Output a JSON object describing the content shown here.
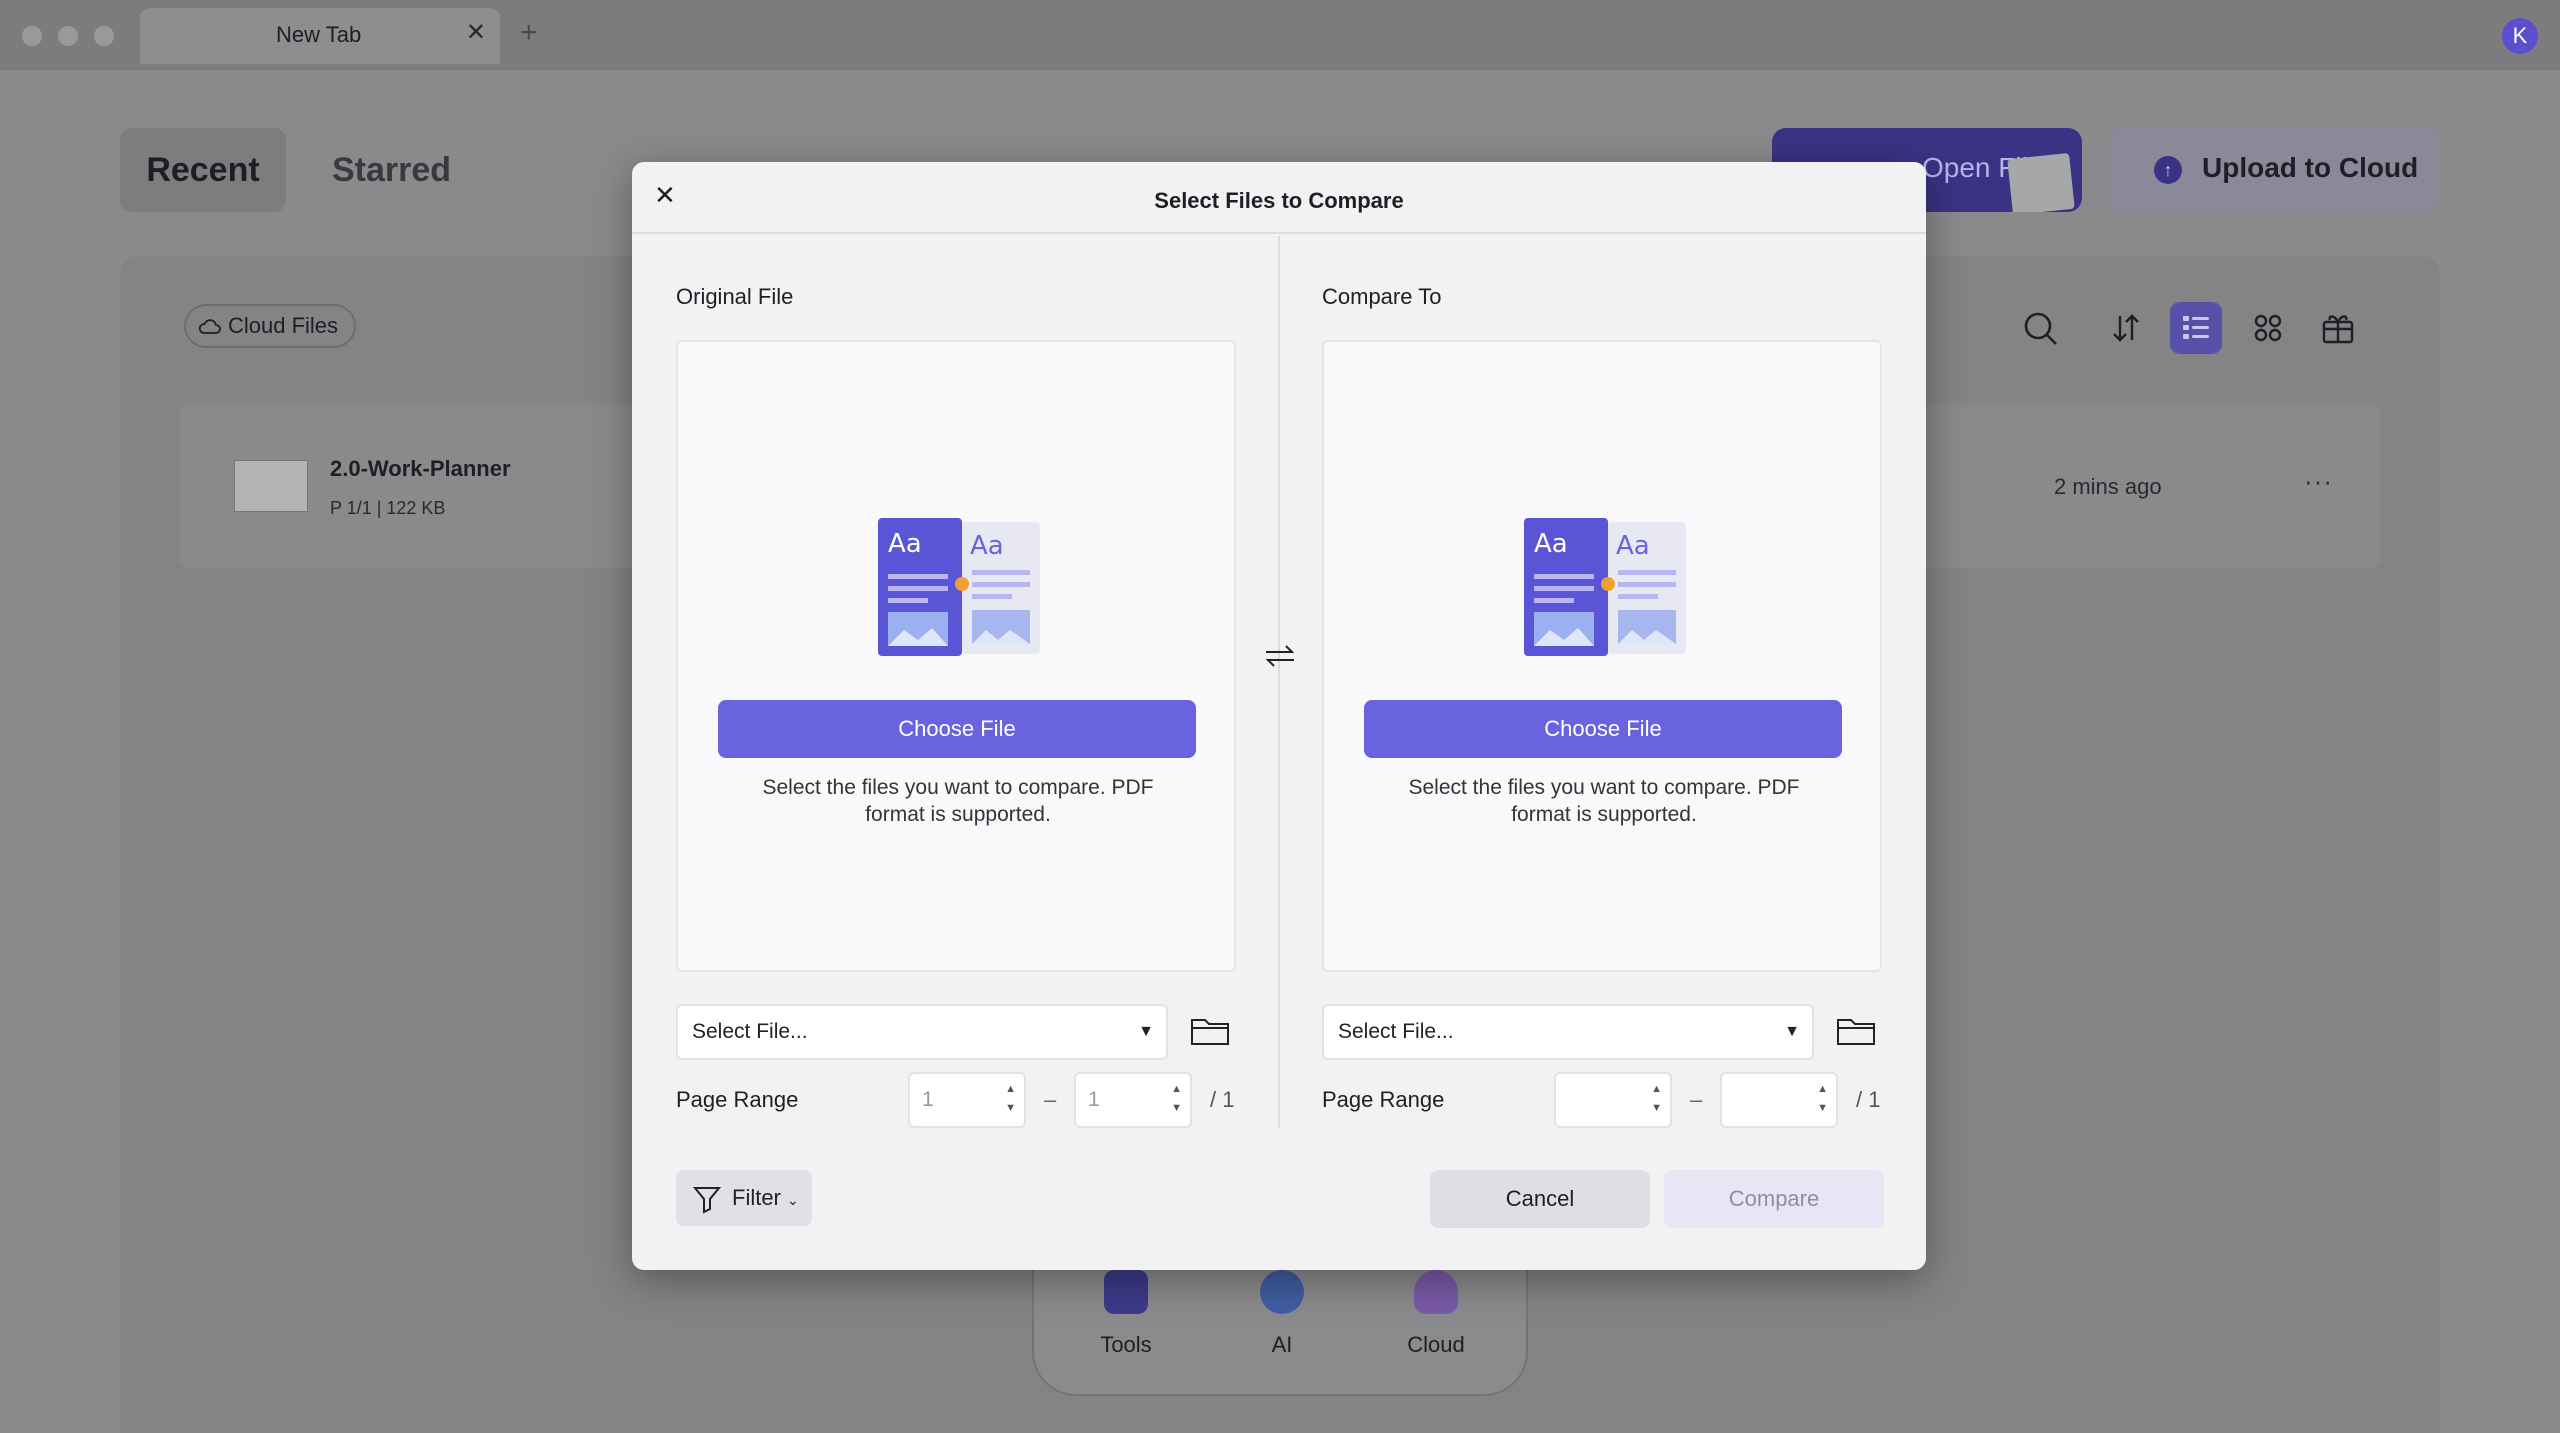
{
  "titlebar": {
    "tab_title": "New Tab",
    "tab_close": "✕",
    "new_tab": "+",
    "avatar_initial": "K"
  },
  "home": {
    "tabs": [
      "Recent",
      "Starred"
    ],
    "open_file_label": "Open File",
    "upload_label": "Upload to Cloud",
    "cloud_files_label": "Cloud Files",
    "file": {
      "name": "2.0-Work-Planner",
      "meta": "P 1/1  |  122 KB",
      "time": "2 mins ago",
      "more": "···"
    },
    "toolbar_icons": [
      "search-icon",
      "sort-icon",
      "list-view-icon",
      "grid-view-icon",
      "basket-icon"
    ]
  },
  "dock": {
    "items": [
      {
        "label": "Tools",
        "icon": "toolbox-icon"
      },
      {
        "label": "AI",
        "icon": "ai-icon"
      },
      {
        "label": "Cloud",
        "icon": "cloud-icon"
      }
    ]
  },
  "modal": {
    "title": "Select Files to Compare",
    "close": "✕",
    "left": {
      "title": "Original File",
      "choose_label": "Choose File",
      "hint": "Select the files you want to compare. PDF format is supported.",
      "select_placeholder": "Select File...",
      "page_range_label": "Page Range",
      "range_from": "1",
      "range_to": "1",
      "range_total": "/ 1"
    },
    "right": {
      "title": "Compare To",
      "choose_label": "Choose File",
      "hint": "Select the files you want to compare. PDF format is supported.",
      "select_placeholder": "Select File...",
      "page_range_label": "Page Range",
      "range_from": "",
      "range_to": "",
      "range_total": "/ 1"
    },
    "range_dash": "–",
    "filter_label": "Filter",
    "cancel_label": "Cancel",
    "compare_label": "Compare"
  },
  "colors": {
    "accent": "#6a63e0",
    "compare_disabled_bg": "#e7e6f4"
  }
}
